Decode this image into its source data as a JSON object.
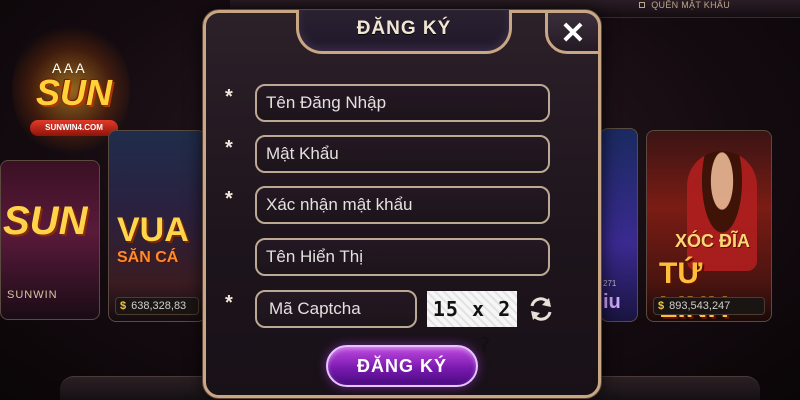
{
  "background": {
    "forgot_password": "QUÊN MẬT KHẨU",
    "logo": {
      "brand": "SUN",
      "ribbon": "SUNWIN4.COM",
      "cards": "A A A"
    },
    "games": [
      {
        "title": "SUN",
        "sub": "SUNWIN",
        "jackpot": ""
      },
      {
        "title": "VUA",
        "sub": "SĂN CÁ",
        "jackpot": "638,328,83"
      },
      {
        "num": "271",
        "title": "iu",
        "jackpot": ""
      },
      {
        "title_line1": "XÓC ĐĨA",
        "title_line2": "TỨ LINH",
        "jackpot": "893,543,247"
      }
    ],
    "currency_symbol": "$"
  },
  "modal": {
    "title": "ĐĂNG KÝ",
    "close_label": "✕",
    "fields": {
      "username": {
        "placeholder": "Tên Đăng Nhập",
        "required_mark": "*"
      },
      "password": {
        "placeholder": "Mật Khẩu",
        "required_mark": "*"
      },
      "confirm_password": {
        "placeholder": "Xác nhận mật khẩu",
        "required_mark": "*"
      },
      "display_name": {
        "placeholder": "Tên Hiển Thị"
      },
      "captcha": {
        "placeholder": "Mã Captcha",
        "required_mark": "*"
      }
    },
    "captcha_challenge": "15 x 2 = ?",
    "submit_label": "ĐĂNG KÝ"
  },
  "icons": {
    "close": "close-icon",
    "refresh": "refresh-icon",
    "lock": "lock-icon",
    "dollar": "dollar-icon"
  },
  "colors": {
    "accent_gold": "#c9a784",
    "button_purple": "#7a1ab0"
  }
}
